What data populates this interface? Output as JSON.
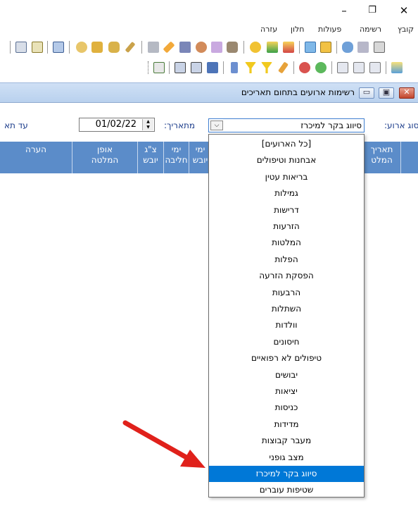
{
  "window_controls": {
    "minimize": "–",
    "maximize": "❐",
    "close": "✕"
  },
  "menu": [
    "קובץ",
    "רשימה",
    "פעולות",
    "חלון",
    "עזרה"
  ],
  "toolbar_icons": {
    "row1": [
      "open-folder-icon",
      "calculator-icon",
      "cow-icon",
      "people-icon",
      "scale-icon",
      "download-icon",
      "upload-icon",
      "medical-icon",
      "search-icon",
      "tools-icon",
      "user-icon",
      "wrench-icon",
      "bottle-icon",
      "text-icon",
      "pen-icon",
      "jar-icon",
      "key-icon",
      "box-icon",
      "chart-icon",
      "grid-icon",
      "table-icon"
    ],
    "row2": [
      "export-icon",
      "page-icon",
      "page-back-icon",
      "page-next-icon",
      "cow-green-icon",
      "cow-red-icon",
      "tag-icon",
      "filter-icon",
      "filter-clear-icon",
      "sort-icon",
      "save-icon",
      "print-icon",
      "print-preview-icon",
      "tree-icon"
    ]
  },
  "child_window": {
    "title": "רשימות ארועים בתחום תאריכים",
    "buttons": {
      "minimize": "▭",
      "restore": "▣",
      "close": "✕"
    }
  },
  "filters": {
    "event_type_label": "סוג ארוע:",
    "event_type_value": "סיווג בקר למיכרז",
    "from_label": "מתאריך:",
    "from_value": "01/02/22",
    "to_label": "עד תא",
    "spin_up": "▲",
    "spin_down": "▼",
    "combo_arrow": "⌵"
  },
  "grid_columns": [
    "תאריך\nהמלט",
    "ימי\nיובש",
    "ימי\nחליבה",
    "צ\"ג\nיובש",
    "אופן\nהמלטה",
    "הערה"
  ],
  "dropdown_items": [
    "[כל הארועים]",
    "אבחנות וטיפולים",
    "בריאות עטין",
    "גמילות",
    "דרישות",
    "הזרעות",
    "המלטות",
    "הפלות",
    "הפסקת הזרעה",
    "הרבעות",
    "השתלות",
    "וולדות",
    "חיסונים",
    "טיפולים לא רפואיים",
    "יבושים",
    "יציאות",
    "כניסות",
    "מדידות",
    "מעבר קבוצות",
    "מצב גופני",
    "סיווג בקר למיכרז",
    "שטיפות עוברים"
  ],
  "dropdown_selected_index": 20,
  "colors": {
    "header_blue": "#5b8cc9",
    "selection_blue": "#0078d7",
    "arrow_red": "#e0211b"
  }
}
